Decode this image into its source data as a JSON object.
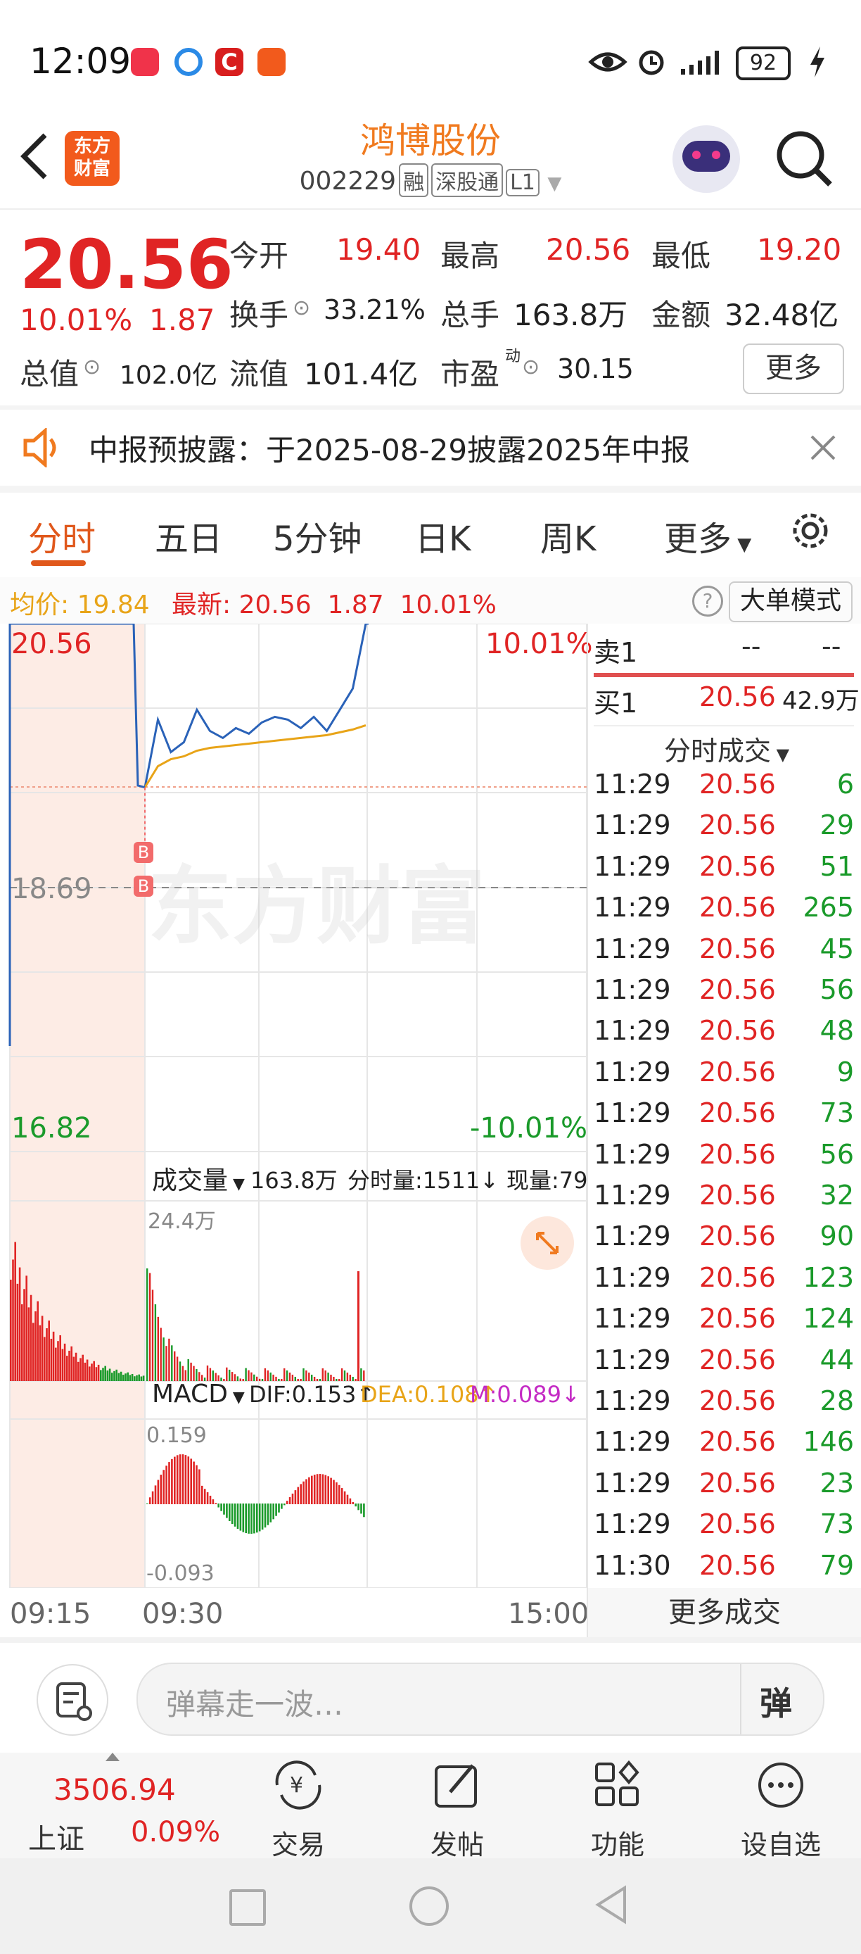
{
  "status_bar": {
    "time": "12:09",
    "battery": "92",
    "icons": [
      "huawei-app-icon",
      "browser-icon",
      "c-app-icon",
      "paper-plane-app-icon",
      "eye-icon",
      "alarm-icon",
      "signal-icon",
      "battery-icon",
      "charging-icon"
    ]
  },
  "header": {
    "back_icon": "chevron-left-icon",
    "logo_text": "东方\n财富",
    "stock_name": "鸿博股份",
    "code": "002229",
    "tags": [
      "融",
      "深股通",
      "L1"
    ],
    "search_icon": "search-icon"
  },
  "quote": {
    "price": "20.56",
    "change_pct": "10.01%",
    "change": "1.87",
    "open_label": "今开",
    "open": "19.40",
    "high_label": "最高",
    "high": "20.56",
    "low_label": "最低",
    "low": "19.20",
    "turnover_label": "换手",
    "turnover": "33.21%",
    "volume_label": "总手",
    "volume": "163.8万",
    "amount_label": "金额",
    "amount": "32.48亿",
    "mktcap_label": "总值",
    "mktcap": "102.0亿",
    "float_label": "流值",
    "float_cap": "101.4亿",
    "pe_label": "市盈",
    "pe_sup": "动",
    "pe": "30.15",
    "more": "更多"
  },
  "notice": {
    "text": "中报预披露：于2025-08-29披露2025年中报"
  },
  "tabs": [
    "分时",
    "五日",
    "5分钟",
    "日K",
    "周K",
    "更多"
  ],
  "infobar": {
    "avg_label": "均价:",
    "avg": "19.84",
    "latest_label": "最新:",
    "latest": "20.56",
    "change": "1.87",
    "pct": "10.01%",
    "mode_button": "大单模式"
  },
  "chart": {
    "y_top": "20.56",
    "y_mid": "18.69",
    "y_bottom": "16.82",
    "pct_top": "10.01%",
    "pct_bottom": "-10.01%",
    "watermark": "东方财富",
    "b_marker": "B",
    "vol_label": "成交量",
    "vol_total": "163.8万",
    "vol_min": "分时量:1511↓",
    "vol_now": "现量:79",
    "vol_max": "24.4万",
    "macd_label": "MACD",
    "dif": "DIF:0.153↑",
    "dea": "DEA:0.108↑",
    "m": "M:0.089↓",
    "macd_top": "0.159",
    "macd_bottom": "-0.093",
    "t_start": "09:15",
    "t_open": "09:30",
    "t_end": "15:00"
  },
  "chart_data": {
    "type": "line",
    "x": [
      "09:30",
      "09:33",
      "09:36",
      "09:40",
      "09:45",
      "09:50",
      "09:55",
      "10:00",
      "10:10",
      "10:20",
      "10:30",
      "10:40",
      "10:50",
      "11:00",
      "11:10",
      "11:20",
      "11:25",
      "11:29"
    ],
    "series": [
      {
        "name": "price",
        "values": [
          19.4,
          19.88,
          19.65,
          19.72,
          19.95,
          19.8,
          19.75,
          19.82,
          19.78,
          19.86,
          19.9,
          19.88,
          19.82,
          19.9,
          19.8,
          19.95,
          20.1,
          20.56
        ]
      },
      {
        "name": "avg",
        "values": [
          19.4,
          19.55,
          19.6,
          19.62,
          19.66,
          19.68,
          19.69,
          19.7,
          19.71,
          19.72,
          19.73,
          19.74,
          19.75,
          19.76,
          19.77,
          19.79,
          19.81,
          19.84
        ]
      }
    ],
    "ylim": [
      16.82,
      20.56
    ]
  },
  "ticks": {
    "sell1_label": "卖1",
    "sell1_price": "--",
    "sell1_vol": "--",
    "buy1_label": "买1",
    "buy1_price": "20.56",
    "buy1_vol": "42.9万",
    "header": "分时成交",
    "rows": [
      [
        "11:29",
        "20.56",
        "6"
      ],
      [
        "11:29",
        "20.56",
        "29"
      ],
      [
        "11:29",
        "20.56",
        "51"
      ],
      [
        "11:29",
        "20.56",
        "265"
      ],
      [
        "11:29",
        "20.56",
        "45"
      ],
      [
        "11:29",
        "20.56",
        "56"
      ],
      [
        "11:29",
        "20.56",
        "48"
      ],
      [
        "11:29",
        "20.56",
        "9"
      ],
      [
        "11:29",
        "20.56",
        "73"
      ],
      [
        "11:29",
        "20.56",
        "56"
      ],
      [
        "11:29",
        "20.56",
        "32"
      ],
      [
        "11:29",
        "20.56",
        "90"
      ],
      [
        "11:29",
        "20.56",
        "123"
      ],
      [
        "11:29",
        "20.56",
        "124"
      ],
      [
        "11:29",
        "20.56",
        "44"
      ],
      [
        "11:29",
        "20.56",
        "28"
      ],
      [
        "11:29",
        "20.56",
        "146"
      ],
      [
        "11:29",
        "20.56",
        "23"
      ],
      [
        "11:29",
        "20.56",
        "73"
      ],
      [
        "11:30",
        "20.56",
        "79"
      ]
    ],
    "more": "更多成交"
  },
  "comment": {
    "placeholder": "弹幕走一波…",
    "danmu_button": "弹"
  },
  "bottom_nav": {
    "index_value": "3506.94",
    "index_name": "上证",
    "index_pct": "0.09%",
    "items": [
      "交易",
      "发帖",
      "功能",
      "设自选"
    ]
  }
}
